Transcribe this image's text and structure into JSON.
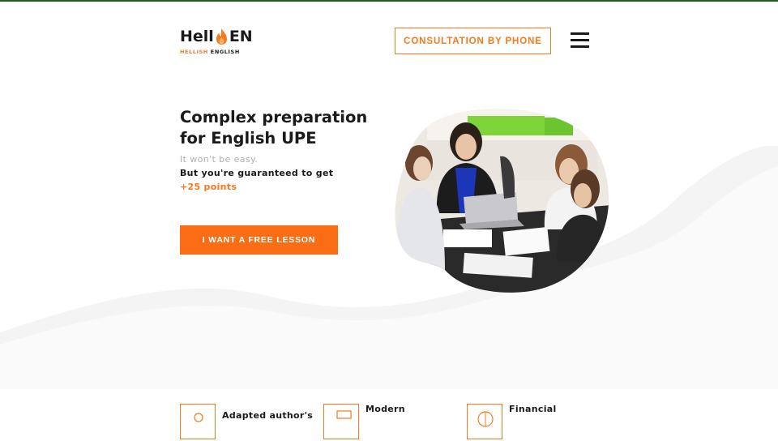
{
  "header": {
    "logo_main_left": "Hell",
    "logo_main_right": "EN",
    "logo_sub_orange": "HELLISH",
    "logo_sub_dark": "ENGLISH",
    "consult_label": "CONSULTATION BY PHONE",
    "menu_icon": "hamburger-menu-icon"
  },
  "hero": {
    "title": "Complex preparation for English UPE",
    "sub1": "It won't be easy.",
    "sub2": "But you're guaranteed to get",
    "sub3": "+25 points",
    "cta_label": "I WANT A FREE LESSON"
  },
  "features": [
    {
      "label": "Adapted author's",
      "icon": "document-icon"
    },
    {
      "label": "Modern",
      "icon": "monitor-icon"
    },
    {
      "label": "Financial",
      "icon": "globe-icon"
    }
  ],
  "colors": {
    "accent": "#f47a20",
    "cta": "#fb6d14",
    "text": "#1a1a1a",
    "muted": "#b0b0b0"
  }
}
